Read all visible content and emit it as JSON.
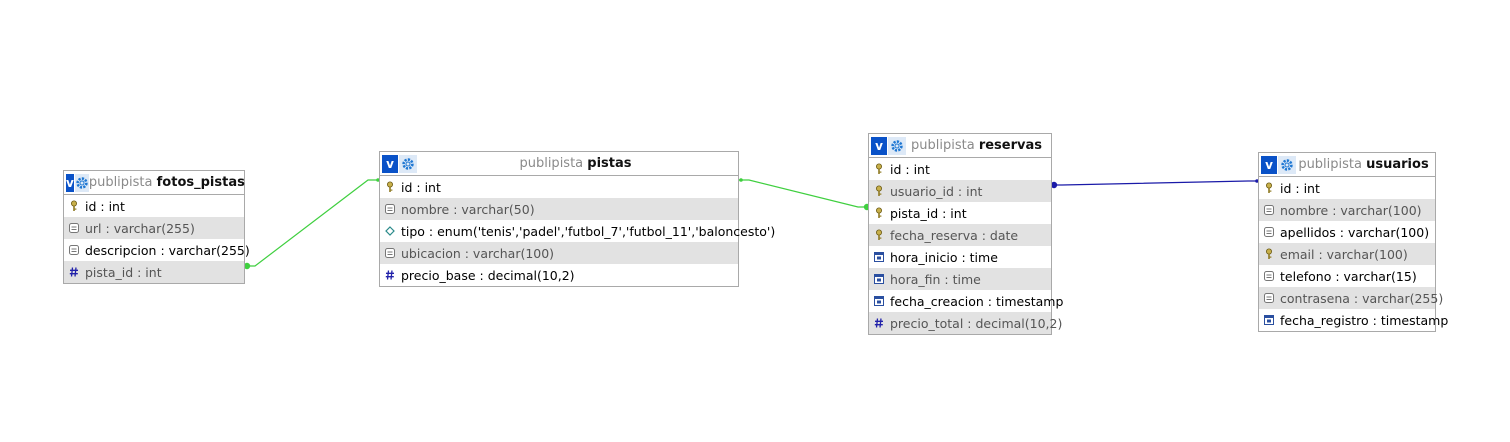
{
  "tables": [
    {
      "db": "publipista",
      "name": "fotos_pistas",
      "columns": [
        {
          "label": "id : int",
          "icon": "key-icon"
        },
        {
          "label": "url : varchar(255)",
          "icon": "text-column-icon"
        },
        {
          "label": "descripcion : varchar(255)",
          "icon": "text-column-icon"
        },
        {
          "label": "pista_id : int",
          "icon": "number-column-icon"
        }
      ]
    },
    {
      "db": "publipista",
      "name": "pistas",
      "columns": [
        {
          "label": "id : int",
          "icon": "key-icon"
        },
        {
          "label": "nombre : varchar(50)",
          "icon": "text-column-icon"
        },
        {
          "label": "tipo : enum('tenis','padel','futbol_7','futbol_11','baloncesto')",
          "icon": "enum-column-icon"
        },
        {
          "label": "ubicacion : varchar(100)",
          "icon": "text-column-icon"
        },
        {
          "label": "precio_base : decimal(10,2)",
          "icon": "number-column-icon"
        }
      ]
    },
    {
      "db": "publipista",
      "name": "reservas",
      "columns": [
        {
          "label": "id : int",
          "icon": "key-icon"
        },
        {
          "label": "usuario_id : int",
          "icon": "key-icon"
        },
        {
          "label": "pista_id : int",
          "icon": "key-icon"
        },
        {
          "label": "fecha_reserva : date",
          "icon": "key-icon"
        },
        {
          "label": "hora_inicio : time",
          "icon": "time-column-icon"
        },
        {
          "label": "hora_fin : time",
          "icon": "time-column-icon"
        },
        {
          "label": "fecha_creacion : timestamp",
          "icon": "time-column-icon"
        },
        {
          "label": "precio_total : decimal(10,2)",
          "icon": "number-column-icon"
        }
      ]
    },
    {
      "db": "publipista",
      "name": "usuarios",
      "columns": [
        {
          "label": "id : int",
          "icon": "key-icon"
        },
        {
          "label": "nombre : varchar(100)",
          "icon": "text-column-icon"
        },
        {
          "label": "apellidos : varchar(100)",
          "icon": "text-column-icon"
        },
        {
          "label": "email : varchar(100)",
          "icon": "key-icon"
        },
        {
          "label": "telefono : varchar(15)",
          "icon": "text-column-icon"
        },
        {
          "label": "contrasena : varchar(255)",
          "icon": "text-column-icon"
        },
        {
          "label": "fecha_registro : timestamp",
          "icon": "time-column-icon"
        }
      ]
    }
  ],
  "colors": {
    "relation_green": "#3fcf3f",
    "relation_blue": "#1a1aa8",
    "toggle_blue": "#0a52c8",
    "row_alt": "#e2e2e2"
  }
}
